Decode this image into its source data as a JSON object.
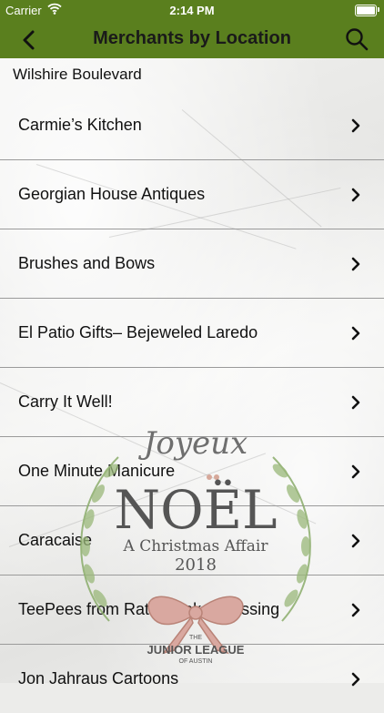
{
  "status_bar": {
    "carrier": "Carrier",
    "time": "2:14 PM"
  },
  "nav": {
    "title": "Merchants by Location",
    "back_icon": "chevron-left-icon",
    "search_icon": "search-icon"
  },
  "section": {
    "title": "Wilshire Boulevard"
  },
  "merchants": [
    {
      "name": "Carmie’s Kitchen"
    },
    {
      "name": "Georgian House Antiques"
    },
    {
      "name": "Brushes and Bows"
    },
    {
      "name": "El Patio Gifts– Bejeweled Laredo"
    },
    {
      "name": "Carry It Well!"
    },
    {
      "name": "One Minute Manicure"
    },
    {
      "name": "Caracaise"
    },
    {
      "name": "TeePees from Rattlesnake Crossing"
    },
    {
      "name": "Jon Jahraus Cartoons"
    }
  ],
  "watermark": {
    "script": "Joyeux",
    "title": "NOËL",
    "subtitle": "A Christmas Affair",
    "year": "2018",
    "org_pre": "THE",
    "org": "JUNIOR LEAGUE",
    "org_post": "OF AUSTIN"
  },
  "colors": {
    "nav_bg": "#5a7f1e",
    "divider": "#9a9a9a",
    "wreath": "#8aab6a",
    "bow": "#d9a8a0"
  }
}
